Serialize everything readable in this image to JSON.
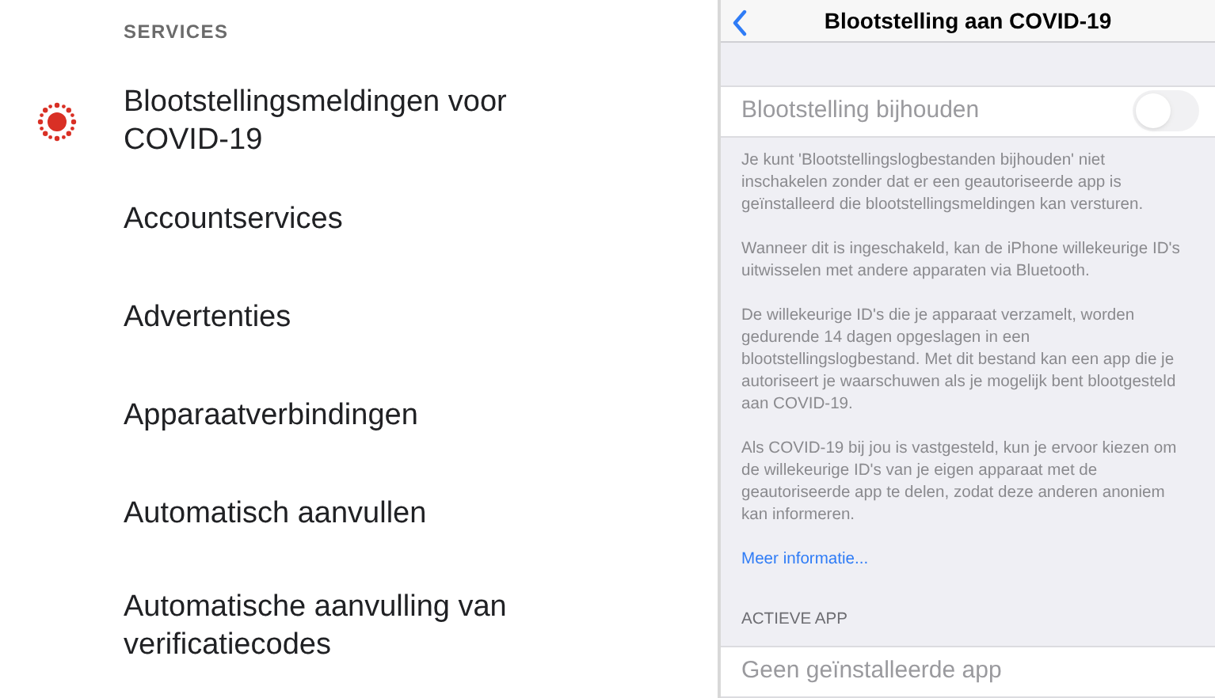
{
  "android_settings": {
    "section_header": "SERVICES",
    "items": [
      {
        "label": "Blootstellingsmeldingen voor COVID-19",
        "kind": "icon"
      },
      {
        "label": "Accountservices",
        "kind": "plain"
      },
      {
        "label": "Advertenties",
        "kind": "plain"
      },
      {
        "label": "Apparaatverbindingen",
        "kind": "plain"
      },
      {
        "label": "Automatisch aanvullen",
        "kind": "plain"
      },
      {
        "label": "Automatische aanvulling van verificatiecodes",
        "kind": "plain"
      }
    ]
  },
  "ios_settings": {
    "nav_title": "Blootstelling aan COVID-19",
    "toggle": {
      "label": "Blootstelling bijhouden",
      "on": false,
      "disabled": true
    },
    "paragraphs": [
      "Je kunt 'Blootstellingslogbestanden bijhouden' niet inschakelen zonder dat er een geautoriseerde app is geïnstalleerd die blootstellingsmeldingen kan versturen.",
      "Wanneer dit is ingeschakeld, kan de iPhone willekeurige ID's uitwisselen met andere apparaten via Bluetooth.",
      "De willekeurige ID's die je apparaat verzamelt, worden gedurende 14 dagen opgeslagen in een blootstellingslogbestand. Met dit bestand kan een app die je autoriseert je waarschuwen als je mogelijk bent blootgesteld aan COVID-19.",
      "Als COVID-19 bij jou is vastgesteld, kun je ervoor kiezen om de willekeurige ID's van je eigen apparaat met de geautoriseerde app te delen, zodat deze anderen anoniem kan informeren."
    ],
    "link": "Meer informatie...",
    "section_header": "ACTIEVE APP",
    "active_app": "Geen geïnstalleerde app"
  }
}
